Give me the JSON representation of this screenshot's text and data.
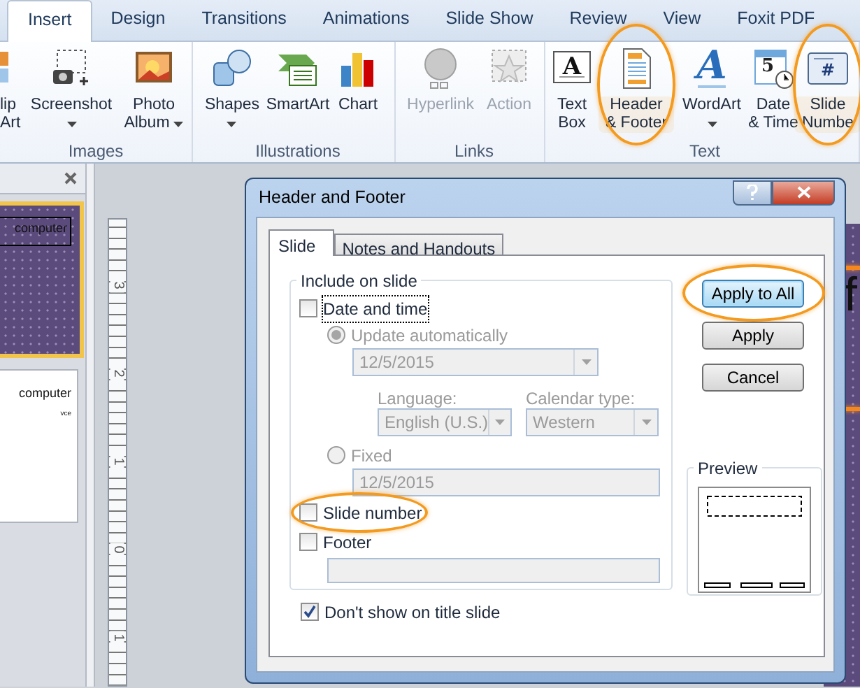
{
  "ribbon_tabs": [
    {
      "label": "Insert",
      "selected": true
    },
    {
      "label": "Design",
      "selected": false
    },
    {
      "label": "Transitions",
      "selected": false
    },
    {
      "label": "Animations",
      "selected": false
    },
    {
      "label": "Slide Show",
      "selected": false
    },
    {
      "label": "Review",
      "selected": false
    },
    {
      "label": "View",
      "selected": false
    },
    {
      "label": "Foxit PDF",
      "selected": false
    }
  ],
  "ribbon_groups": [
    {
      "name": "Images",
      "items": [
        {
          "label": "lip\nArt",
          "dropdown": false,
          "disabled": false,
          "highlighted": false
        },
        {
          "label": "Screenshot",
          "dropdown": true,
          "disabled": false,
          "highlighted": false
        },
        {
          "label": "Photo\nAlbum",
          "dropdown": true,
          "disabled": false,
          "highlighted": false
        }
      ]
    },
    {
      "name": "Illustrations",
      "items": [
        {
          "label": "Shapes",
          "dropdown": true,
          "disabled": false,
          "highlighted": false
        },
        {
          "label": "SmartArt",
          "dropdown": false,
          "disabled": false,
          "highlighted": false
        },
        {
          "label": "Chart",
          "dropdown": false,
          "disabled": false,
          "highlighted": false
        }
      ]
    },
    {
      "name": "Links",
      "items": [
        {
          "label": "Hyperlink",
          "dropdown": false,
          "disabled": true,
          "highlighted": false
        },
        {
          "label": "Action",
          "dropdown": false,
          "disabled": true,
          "highlighted": false
        }
      ]
    },
    {
      "name": "Text",
      "items": [
        {
          "label": "Text\nBox",
          "glyph": "A",
          "dropdown": false,
          "disabled": false,
          "highlighted": false
        },
        {
          "label": "Header\n& Footer",
          "dropdown": false,
          "disabled": false,
          "highlighted": true
        },
        {
          "label": "WordArt",
          "glyph": "A",
          "dropdown": true,
          "disabled": false,
          "highlighted": false
        },
        {
          "label": "Date\n& Time",
          "glyph": "5",
          "dropdown": false,
          "disabled": false,
          "highlighted": false
        },
        {
          "label": "Slide\nNumbe",
          "glyph": "#",
          "dropdown": false,
          "disabled": false,
          "highlighted": true
        }
      ]
    }
  ],
  "slides_pane": {
    "slides": [
      {
        "selected": true,
        "texts": [
          "computer"
        ]
      },
      {
        "selected": false,
        "texts": [
          "computer",
          "vce"
        ]
      }
    ]
  },
  "ruler": {
    "labels": [
      "3",
      "2",
      "1",
      "0",
      "1"
    ]
  },
  "slide_edge": {
    "text": "f"
  },
  "dialog": {
    "title": "Header and Footer",
    "tabs": [
      {
        "label": "Slide",
        "selected": true
      },
      {
        "label": "Notes and Handouts",
        "selected": false
      }
    ],
    "group_title": "Include on slide",
    "options": [
      {
        "kind": "checkbox",
        "label": "Date and time",
        "checked": false,
        "focused": true,
        "disabled": false,
        "highlighted": false
      },
      {
        "kind": "radio",
        "label": "Update automatically",
        "selected": true,
        "disabled": true
      },
      {
        "kind": "select",
        "value": "12/5/2015",
        "disabled": true
      },
      {
        "kind": "select_pair",
        "disabled": true,
        "selects": [
          {
            "label": "Language:",
            "value": "English (U.S.)"
          },
          {
            "label": "Calendar type:",
            "value": "Western"
          }
        ]
      },
      {
        "kind": "radio",
        "label": "Fixed",
        "selected": false,
        "disabled": true
      },
      {
        "kind": "field",
        "value": "12/5/2015",
        "disabled": true
      },
      {
        "kind": "checkbox",
        "label": "Slide number",
        "checked": false,
        "focused": false,
        "disabled": false,
        "highlighted": true
      },
      {
        "kind": "checkbox",
        "label": "Footer",
        "checked": false,
        "focused": false,
        "disabled": false,
        "highlighted": false
      },
      {
        "kind": "field",
        "disabled": true
      }
    ],
    "title_slide_option": {
      "label": "Don't show on title slide",
      "checked": true
    },
    "buttons": [
      {
        "label": "Apply to All",
        "default": true,
        "highlighted": true
      },
      {
        "label": "Apply",
        "default": false,
        "highlighted": false
      },
      {
        "label": "Cancel",
        "default": false,
        "highlighted": false
      }
    ],
    "preview": {
      "title": "Preview"
    }
  }
}
